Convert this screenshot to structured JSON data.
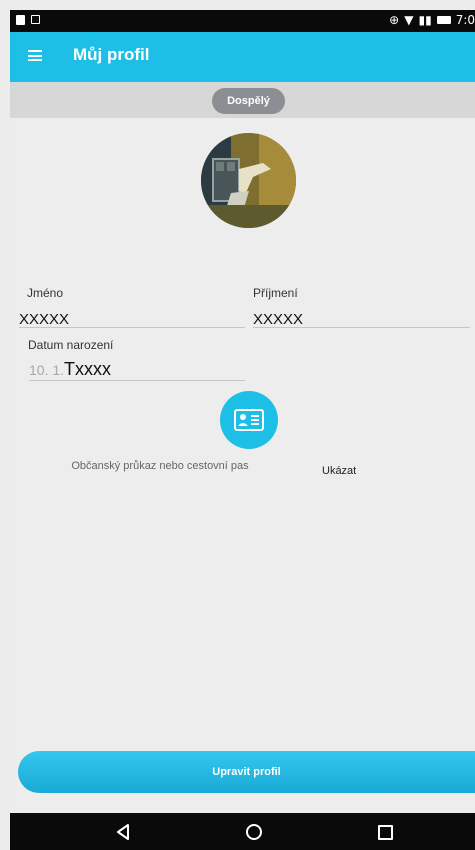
{
  "status_bar": {
    "clock": "7:0"
  },
  "app_bar": {
    "title": "Můj profil"
  },
  "category_badge": "Dospělý",
  "fields": {
    "first_name": {
      "label": "Jméno",
      "value": "XXXXX"
    },
    "last_name": {
      "label": "Příjmení",
      "value": "XXXXX"
    },
    "birth_date": {
      "label": "Datum narození",
      "value_prefix": "10. 1.",
      "value": "Txxxx"
    }
  },
  "document": {
    "label": "Občanský průkaz nebo cestovní pas",
    "action": "Ukázat"
  },
  "edit_button": "Upravit profil",
  "colors": {
    "accent": "#1ebfe7",
    "badge": "#8b8e93",
    "background": "#ededed"
  }
}
